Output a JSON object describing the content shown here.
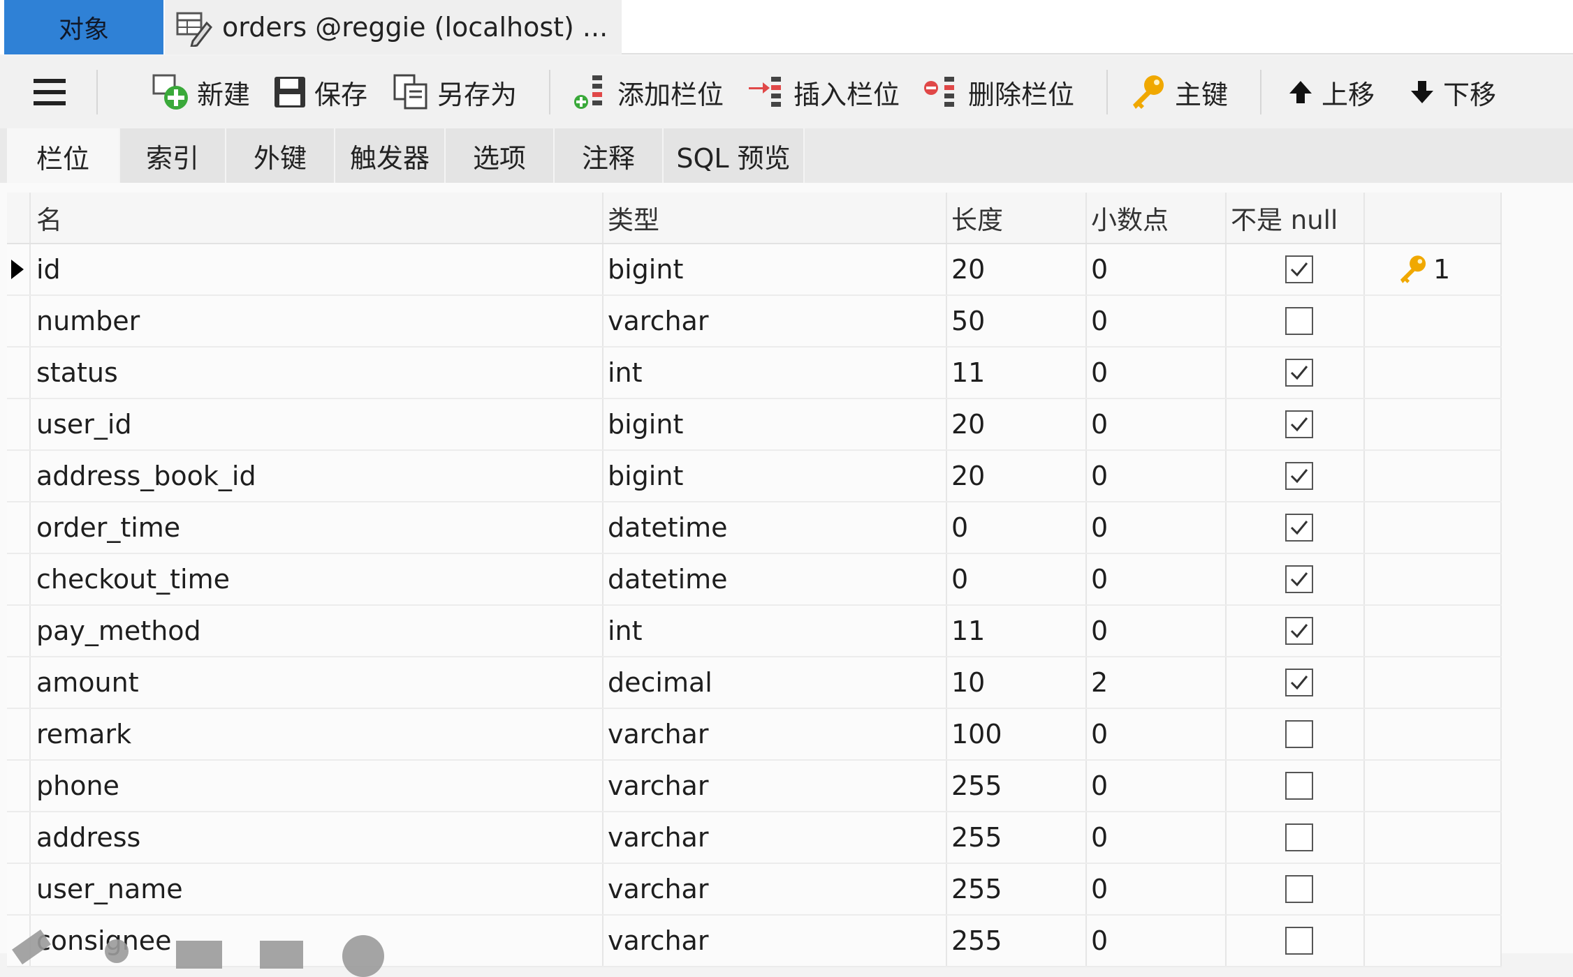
{
  "tabs": {
    "objects_label": "对象",
    "document_label": "orders @reggie (localhost) ..."
  },
  "toolbar": {
    "new_label": "新建",
    "save_label": "保存",
    "saveas_label": "另存为",
    "add_field_label": "添加栏位",
    "insert_field_label": "插入栏位",
    "delete_field_label": "删除栏位",
    "primary_key_label": "主键",
    "move_up_label": "上移",
    "move_down_label": "下移"
  },
  "subtabs": [
    "栏位",
    "索引",
    "外键",
    "触发器",
    "选项",
    "注释",
    "SQL 预览"
  ],
  "grid": {
    "headers": {
      "name": "名",
      "type": "类型",
      "length": "长度",
      "decimals": "小数点",
      "not_null": "不是 null"
    },
    "rows": [
      {
        "name": "id",
        "type": "bigint",
        "length": "20",
        "decimals": "0",
        "not_null": true,
        "key": "1"
      },
      {
        "name": "number",
        "type": "varchar",
        "length": "50",
        "decimals": "0",
        "not_null": false,
        "key": ""
      },
      {
        "name": "status",
        "type": "int",
        "length": "11",
        "decimals": "0",
        "not_null": true,
        "key": ""
      },
      {
        "name": "user_id",
        "type": "bigint",
        "length": "20",
        "decimals": "0",
        "not_null": true,
        "key": ""
      },
      {
        "name": "address_book_id",
        "type": "bigint",
        "length": "20",
        "decimals": "0",
        "not_null": true,
        "key": ""
      },
      {
        "name": "order_time",
        "type": "datetime",
        "length": "0",
        "decimals": "0",
        "not_null": true,
        "key": ""
      },
      {
        "name": "checkout_time",
        "type": "datetime",
        "length": "0",
        "decimals": "0",
        "not_null": true,
        "key": ""
      },
      {
        "name": "pay_method",
        "type": "int",
        "length": "11",
        "decimals": "0",
        "not_null": true,
        "key": ""
      },
      {
        "name": "amount",
        "type": "decimal",
        "length": "10",
        "decimals": "2",
        "not_null": true,
        "key": ""
      },
      {
        "name": "remark",
        "type": "varchar",
        "length": "100",
        "decimals": "0",
        "not_null": false,
        "key": ""
      },
      {
        "name": "phone",
        "type": "varchar",
        "length": "255",
        "decimals": "0",
        "not_null": false,
        "key": ""
      },
      {
        "name": "address",
        "type": "varchar",
        "length": "255",
        "decimals": "0",
        "not_null": false,
        "key": ""
      },
      {
        "name": "user_name",
        "type": "varchar",
        "length": "255",
        "decimals": "0",
        "not_null": false,
        "key": ""
      },
      {
        "name": "consignee",
        "type": "varchar",
        "length": "255",
        "decimals": "0",
        "not_null": false,
        "key": ""
      }
    ]
  },
  "colors": {
    "accent_tab": "#2f81d6",
    "key_icon": "#f0a800",
    "new_icon": "#3aa93a",
    "delete_icon": "#e04848"
  }
}
